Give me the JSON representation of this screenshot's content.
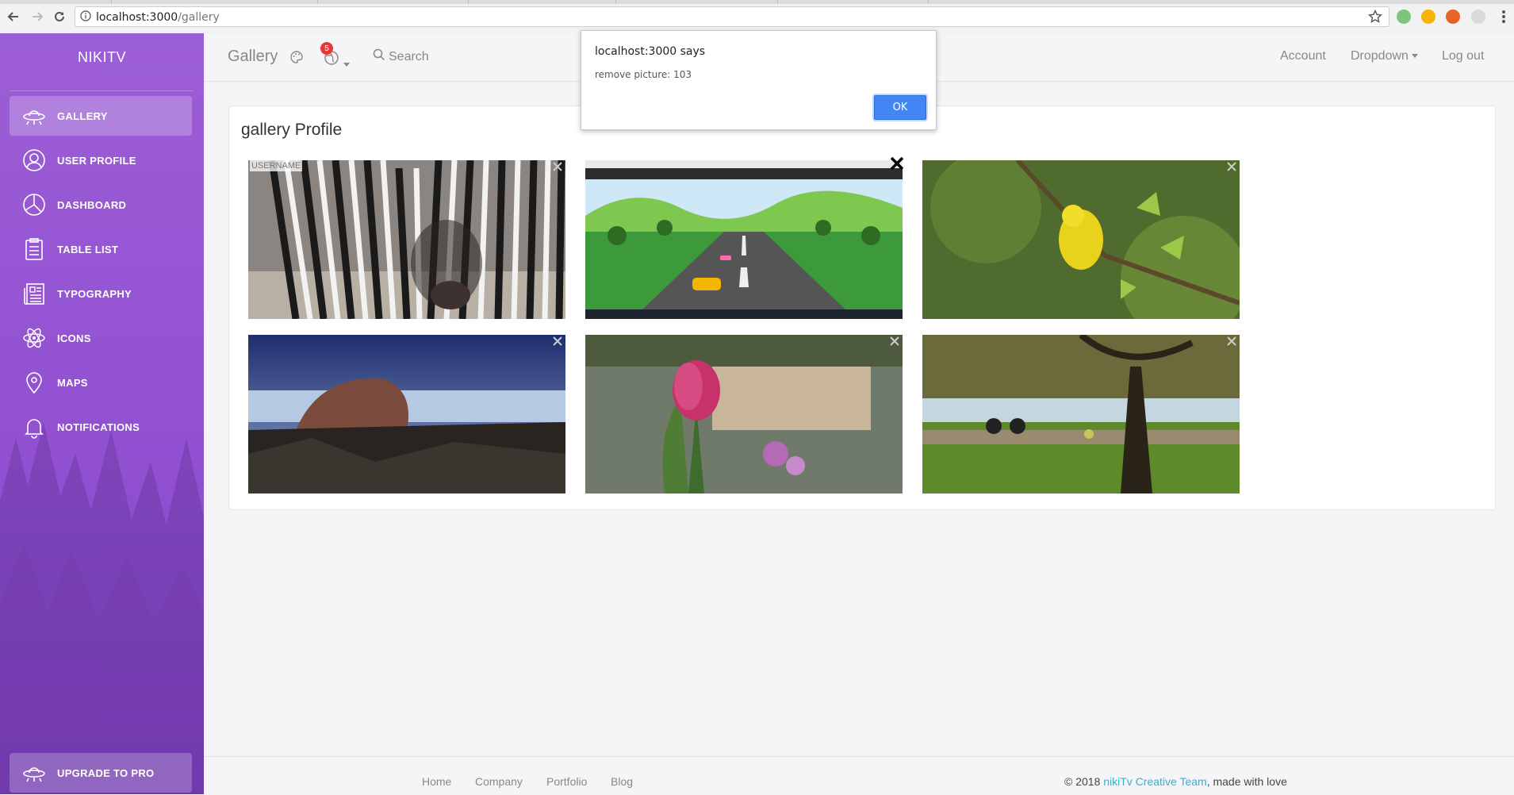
{
  "browser": {
    "url_host": "localhost:3000",
    "url_path": "/gallery"
  },
  "sidebar": {
    "brand": "NIKITV",
    "items": [
      {
        "label": "GALLERY",
        "icon": "ufo-icon",
        "active": true
      },
      {
        "label": "USER PROFILE",
        "icon": "user-icon"
      },
      {
        "label": "DASHBOARD",
        "icon": "pie-chart-icon"
      },
      {
        "label": "TABLE LIST",
        "icon": "clipboard-icon"
      },
      {
        "label": "TYPOGRAPHY",
        "icon": "news-icon"
      },
      {
        "label": "ICONS",
        "icon": "atom-icon"
      },
      {
        "label": "MAPS",
        "icon": "map-pin-icon"
      },
      {
        "label": "NOTIFICATIONS",
        "icon": "bell-icon"
      }
    ],
    "upgrade_label": "UPGRADE TO PRO",
    "accent": "#9a5bd6"
  },
  "topnav": {
    "title": "Gallery",
    "notification_count": "5",
    "search_placeholder": "Search",
    "account": "Account",
    "dropdown": "Dropdown",
    "logout": "Log out"
  },
  "gallery": {
    "title": "gallery Profile",
    "username_tag": "USERNAME",
    "images": [
      {
        "subject": "zebra"
      },
      {
        "subject": "racing-game-screenshot"
      },
      {
        "subject": "yellow-bird"
      },
      {
        "subject": "coastal-rocks"
      },
      {
        "subject": "pink-tulip"
      },
      {
        "subject": "park-cyclists"
      }
    ]
  },
  "footer": {
    "links": [
      "Home",
      "Company",
      "Portfolio",
      "Blog"
    ],
    "copy_prefix": "© 2018 ",
    "team": "nikiTv Creative Team",
    "copy_suffix": ", made with love",
    "team_color": "#2eb3d6"
  },
  "dialog": {
    "title": "localhost:3000 says",
    "message": "remove picture: 103",
    "ok": "OK"
  }
}
